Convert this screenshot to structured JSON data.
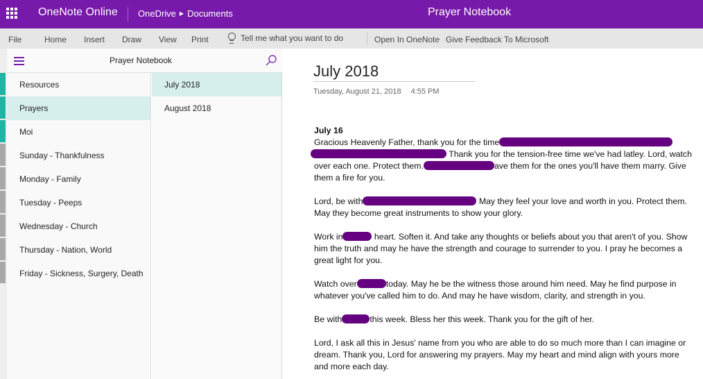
{
  "topbar": {
    "app_name": "OneNote Online",
    "breadcrumb": [
      "OneDrive",
      "Documents"
    ],
    "document_title": "Prayer Notebook",
    "brand_color": "#7719aa"
  },
  "ribbon": {
    "tabs": [
      "File",
      "Home",
      "Insert",
      "Draw",
      "View",
      "Print"
    ],
    "tell_me_placeholder": "Tell me what you want to do",
    "open_in_onenote": "Open In OneNote",
    "give_feedback": "Give Feedback To Microsoft"
  },
  "navigation": {
    "notebook_title": "Prayer Notebook",
    "sections": [
      {
        "label": "Resources",
        "color": "#1fb5a4"
      },
      {
        "label": "Prayers",
        "color": "#1fb5a4",
        "selected": true
      },
      {
        "label": "Moi",
        "color": "#1fb5a4"
      },
      {
        "label": "Sunday - Thankfulness",
        "color": "#a8a8a8"
      },
      {
        "label": "Monday - Family",
        "color": "#a8a8a8"
      },
      {
        "label": "Tuesday - Peeps",
        "color": "#a8a8a8"
      },
      {
        "label": "Wednesday - Church",
        "color": "#a8a8a8"
      },
      {
        "label": "Thursday - Nation, World",
        "color": "#a8a8a8"
      },
      {
        "label": "Friday - Sickness, Surgery, Death",
        "color": "#a8a8a8"
      }
    ],
    "pages": [
      {
        "label": "July 2018",
        "selected": true
      },
      {
        "label": "August 2018"
      }
    ],
    "selected_color": "#d7efec"
  },
  "page": {
    "title": "July 2018",
    "date": "Tuesday, August 21, 2018",
    "time": "4:55 PM",
    "heading": "July 16",
    "paragraphs": {
      "p1_a": "Gracious Heavenly Father, thank you for the time",
      "p1_b": " Thank you for the tension-free time we've had latley. Lord, watch over each one. Protect them.",
      "p1_c": "ave them for the ones you'll have them marry. Give them a fire for you.",
      "p2_a": "Lord, be with",
      "p2_b": " May they feel your love and worth in you. Protect them. May they become great instruments to show your glory.",
      "p3_a": "Work in",
      "p3_b": " heart. Soften it. And take any thoughts or beliefs about you that aren't of you. Show him the truth and may he have the strength and courage to surrender to you.  I pray he becomes a great light for you.",
      "p4_a": "Watch over",
      "p4_b": "today. May he be the witness those around him need. May he find purpose in whatever you've called him to do. And may he have wisdom, clarity, and strength in you.",
      "p5_a": "Be with",
      "p5_b": "this week. Bless her this week. Thank you for the gift of her.",
      "p6": "Lord, I ask all this in Jesus' name from you who are able to do so much more than I can imagine or dream. Thank you, Lord for answering my prayers.  May my heart and mind align with yours more and more each day."
    },
    "redaction_color": "#650080"
  }
}
